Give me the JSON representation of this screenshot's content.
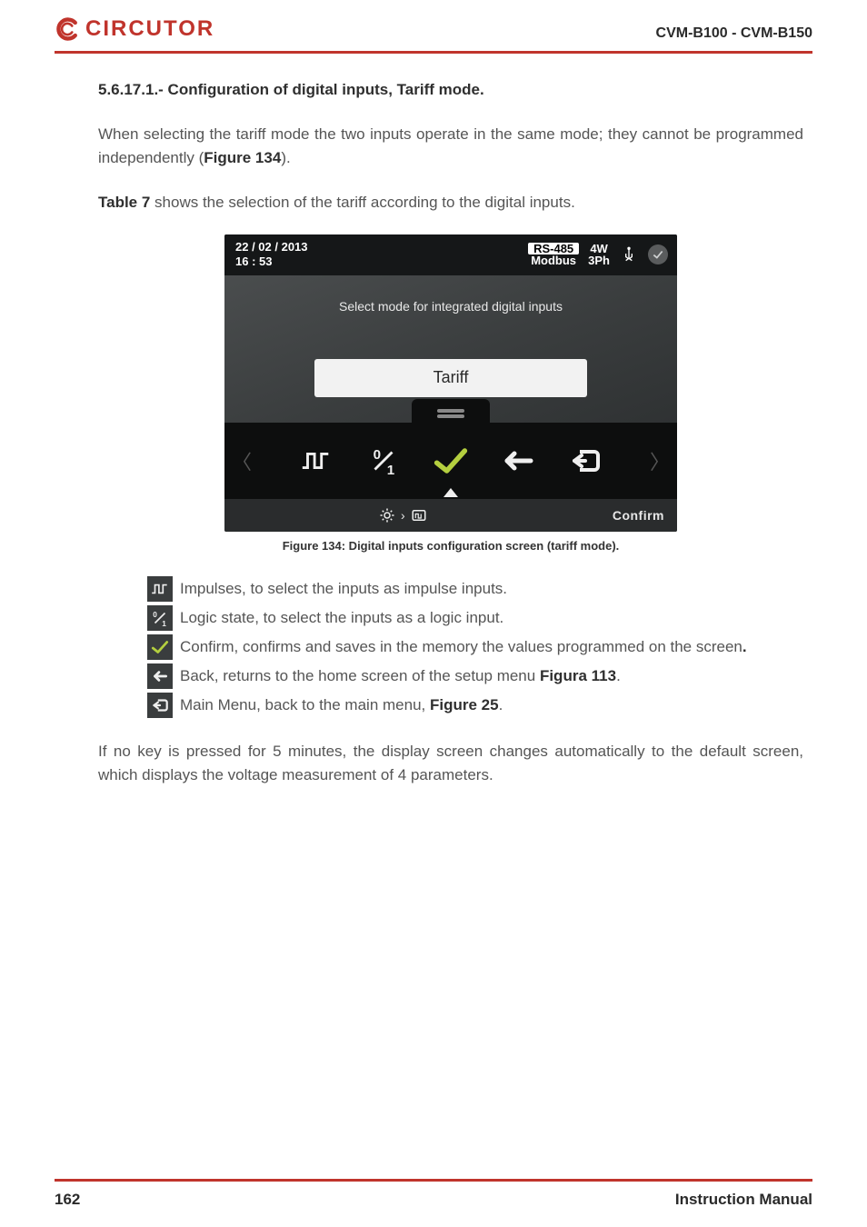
{
  "header": {
    "brand": "CIRCUTOR",
    "model": "CVM-B100 - CVM-B150"
  },
  "section": {
    "heading": "5.6.17.1.- Configuration of digital inputs, Tariff mode.",
    "para1_a": "When selecting the tariff mode the two inputs operate in the same mode; they cannot be programmed independently (",
    "para1_figref": "Figure 134",
    "para1_b": ").",
    "para2_a": "Table 7",
    "para2_b": " shows the selection of the tariff according to the digital inputs."
  },
  "device": {
    "date": "22 / 02 / 2013",
    "time": "16 : 53",
    "comm_top": "RS-485",
    "comm_bot": "Modbus",
    "wiring_top": "4W",
    "wiring_bot": "3Ph",
    "body_title": "Select mode for integrated digital inputs",
    "selected": "Tariff",
    "confirm": "Confirm"
  },
  "figure_caption": "Figure 134: Digital inputs configuration screen (tariff mode).",
  "legend": {
    "impulses": " Impulses, to select the inputs as impulse inputs.",
    "logic": " Logic state, to select the inputs as a logic input.",
    "confirm": "Confirm, confirms and saves in the memory the values programmed on the screen",
    "back_a": "Back, returns to the home screen of the setup menu ",
    "back_ref": "Figura 113",
    "back_b": ".",
    "main_a": "Main Menu, back to the main menu, ",
    "main_ref": "Figure 25",
    "main_b": "."
  },
  "timeout": "If no key is pressed for 5 minutes, the display screen changes automatically to the default screen, which displays the voltage measurement of 4 parameters.",
  "footer": {
    "page": "162",
    "title": "Instruction Manual"
  }
}
